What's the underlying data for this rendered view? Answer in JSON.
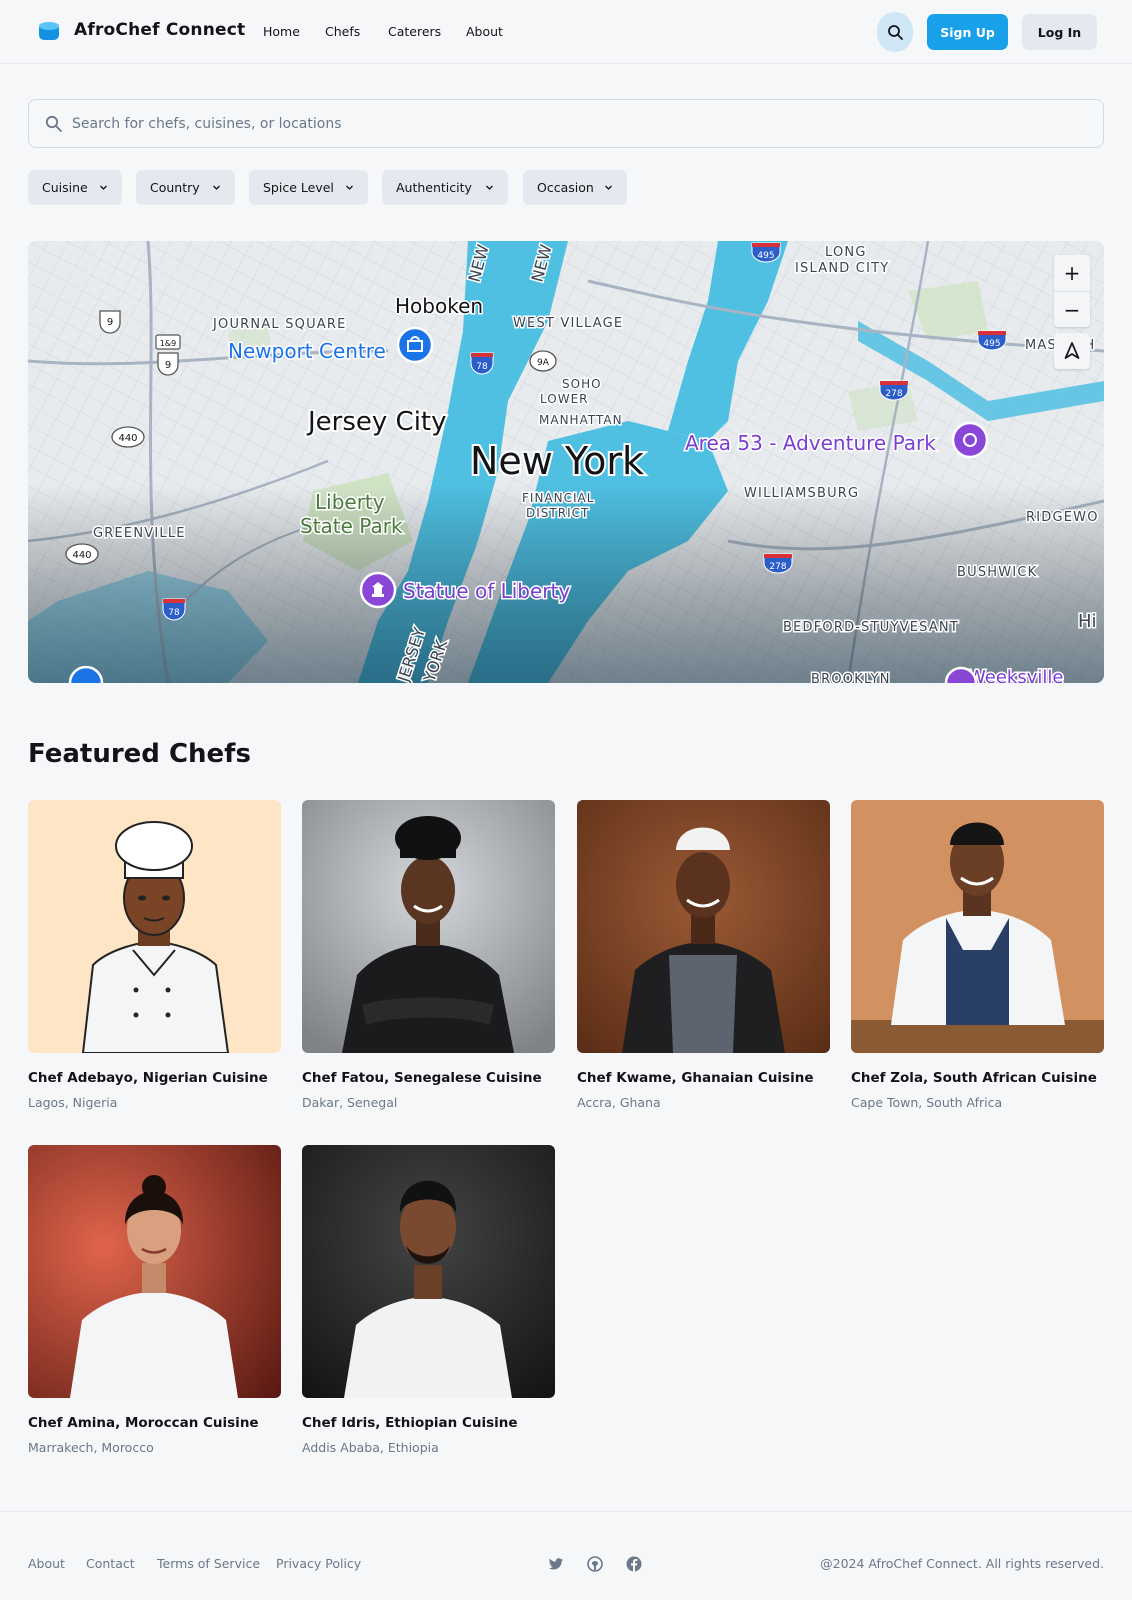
{
  "header": {
    "logo_text": "AfroChef Connect",
    "nav": [
      "Home",
      "Chefs",
      "Caterers",
      "About"
    ],
    "signup_label": "Sign Up",
    "login_label": "Log In",
    "accent_color": "#18a0e8"
  },
  "search": {
    "placeholder": "Search for chefs, cuisines, or locations"
  },
  "filters": [
    "Cuisine",
    "Country",
    "Spice Level",
    "Authenticity",
    "Occasion"
  ],
  "map": {
    "labels": {
      "hoboken": "Hoboken",
      "journal_square": "JOURNAL SQUARE",
      "newport_centre": "Newport Centre",
      "west_village": "WEST VILLAGE",
      "soho": "SOHO",
      "lower_manhattan": "LOWER MANHATTAN",
      "jersey_city": "Jersey City",
      "new_york": "New York",
      "area53": "Area 53 - Adventure Park",
      "liberty_state_park": "Liberty State Park",
      "financial_district": "FINANCIAL DISTRICT",
      "williamsburg": "WILLIAMSBURG",
      "greenville": "GREENVILLE",
      "statue_of_liberty": "Statue of Liberty",
      "bushwick": "BUSHWICK",
      "ridgewood": "RIDGEWO",
      "bedford": "BEDFORD-STUYVESANT",
      "long_island_city": "LONG ISLAND CITY",
      "maspeth": "MASPETH",
      "brooklyn": "BROOKLYN",
      "weeksville": "Weeksville",
      "jersey_york_1": "JERSEY",
      "jersey_york_2": "YORK"
    },
    "shields": {
      "s9a": "9",
      "s1": "1&9",
      "s9b": "9",
      "s440a": "440",
      "s440b": "440",
      "s78a": "78",
      "s78b": "78",
      "s9A": "9A",
      "s278a": "278",
      "s278b": "278",
      "s495a": "495",
      "s495b": "495"
    },
    "zoom_in": "+",
    "zoom_out": "−"
  },
  "featured": {
    "title": "Featured Chefs",
    "chefs": [
      {
        "name": "Chef Adebayo, Nigerian Cuisine",
        "location": "Lagos, Nigeria"
      },
      {
        "name": "Chef Fatou, Senegalese Cuisine",
        "location": "Dakar, Senegal"
      },
      {
        "name": "Chef Kwame, Ghanaian Cuisine",
        "location": "Accra, Ghana"
      },
      {
        "name": "Chef Zola, South African Cuisine",
        "location": "Cape Town, South Africa"
      },
      {
        "name": "Chef Amina, Moroccan Cuisine",
        "location": "Marrakech, Morocco"
      },
      {
        "name": "Chef Idris, Ethiopian Cuisine",
        "location": "Addis Ababa, Ethiopia"
      }
    ]
  },
  "footer": {
    "links": [
      "About",
      "Contact",
      "Terms of Service",
      "Privacy Policy"
    ],
    "social": [
      "twitter-icon",
      "github-icon",
      "facebook-icon"
    ],
    "copyright": "@2024 AfroChef Connect. All rights reserved."
  }
}
